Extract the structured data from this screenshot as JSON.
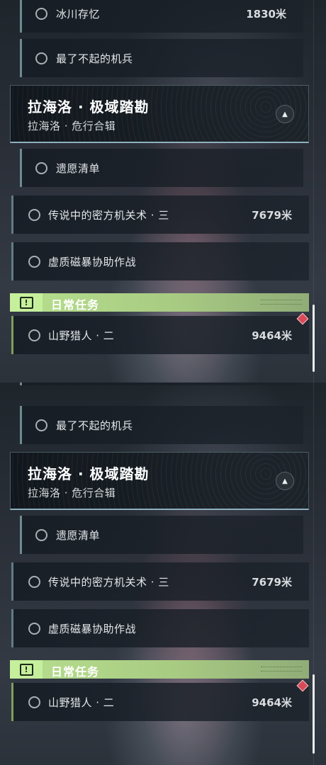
{
  "tasks": {
    "glacier": {
      "label": "冰川存忆",
      "distance": "1830米"
    },
    "mech": {
      "label": "最了不起的机兵"
    },
    "wishlist": {
      "label": "遗愿清单"
    },
    "legend": {
      "label": "传说中的密方机关术 · 三",
      "distance": "7679米"
    },
    "storm": {
      "label": "虚质磁暴协助作战"
    },
    "hunter": {
      "label": "山野猎人 · 二",
      "distance": "9464米"
    }
  },
  "region": {
    "title": "拉海洛 · 极域踏勘",
    "subtitle": "拉海洛 · 危行合辑"
  },
  "daily": {
    "title": "日常任务",
    "icon": "alert-box-icon"
  },
  "colors": {
    "accent_green": "#b7df8e",
    "marker_red": "#d94a59",
    "row_accent": "#5f7c88"
  }
}
